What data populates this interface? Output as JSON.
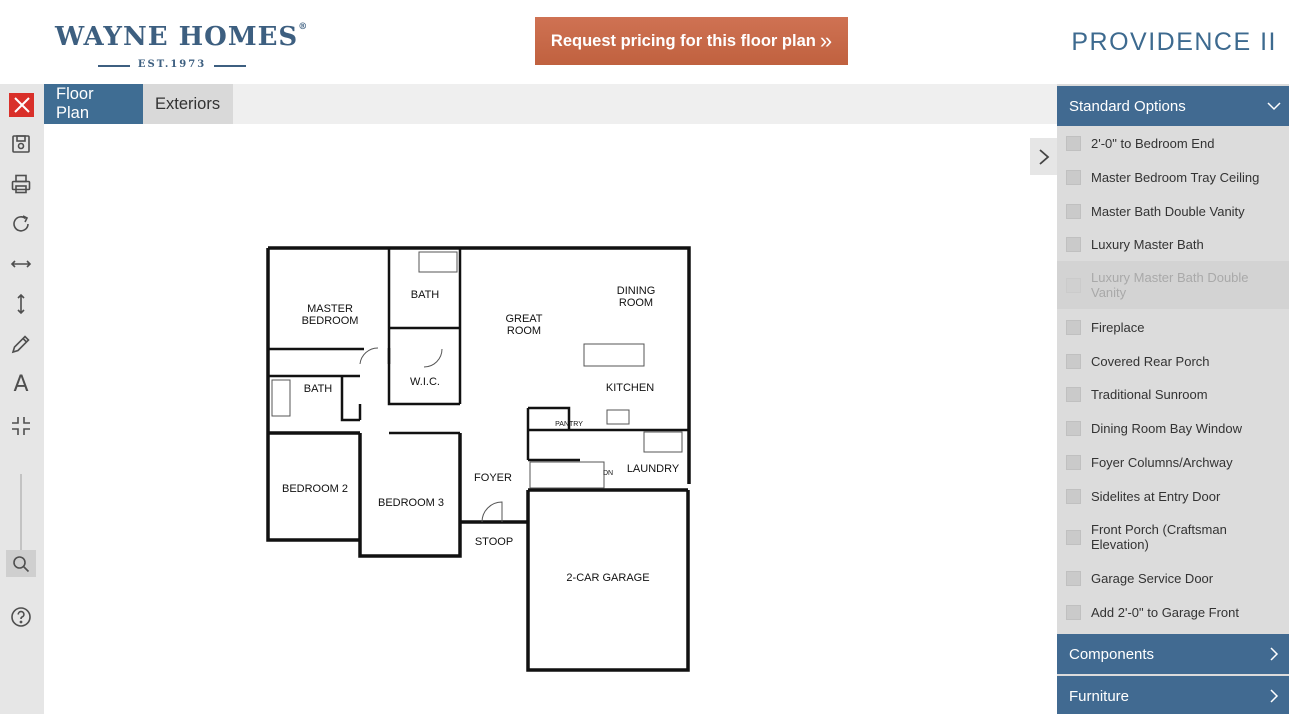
{
  "header": {
    "logo_main": "WAYNE HOMES",
    "logo_reg": "®",
    "logo_est": "EST.1973",
    "pricing_label": "Request pricing for this floor plan",
    "pricing_chevrons": "»",
    "plan_name": "PROVIDENCE II"
  },
  "tabs": [
    {
      "label": "Floor Plan"
    },
    {
      "label": "Exteriors"
    }
  ],
  "toolbar": {
    "text_tool": "A",
    "icons": [
      "close-icon",
      "save-icon",
      "print-icon",
      "redo-icon",
      "horizontal-measure-icon",
      "vertical-measure-icon",
      "pencil-icon",
      "text-icon",
      "collapse-icon",
      "search-icon",
      "help-icon"
    ]
  },
  "floorplan": {
    "rooms": {
      "master_bedroom_1": "MASTER",
      "master_bedroom_2": "BEDROOM",
      "bath_top": "BATH",
      "great_room_1": "GREAT",
      "great_room_2": "ROOM",
      "dining_1": "DINING",
      "dining_2": "ROOM",
      "wic": "W.I.C.",
      "bath_left": "BATH",
      "kitchen": "KITCHEN",
      "pantry": "PANTRY",
      "laundry": "LAUNDRY",
      "dn": "DN",
      "foyer": "FOYER",
      "bedroom2": "BEDROOM 2",
      "bedroom3": "BEDROOM 3",
      "stoop": "STOOP",
      "garage": "2-CAR GARAGE"
    }
  },
  "panel": {
    "standard_options": "Standard Options",
    "options": [
      {
        "label": "2'-0\" to Bedroom End",
        "disabled": false
      },
      {
        "label": "Master Bedroom Tray Ceiling",
        "disabled": false
      },
      {
        "label": "Master Bath Double Vanity",
        "disabled": false
      },
      {
        "label": "Luxury Master Bath",
        "disabled": false
      },
      {
        "label": "Luxury Master Bath Double Vanity",
        "disabled": true
      },
      {
        "label": "Fireplace",
        "disabled": false
      },
      {
        "label": "Covered Rear Porch",
        "disabled": false
      },
      {
        "label": "Traditional Sunroom",
        "disabled": false
      },
      {
        "label": "Dining Room Bay Window",
        "disabled": false
      },
      {
        "label": "Foyer Columns/Archway",
        "disabled": false
      },
      {
        "label": "Sidelites at Entry Door",
        "disabled": false
      },
      {
        "label": "Front Porch (Craftsman Elevation)",
        "disabled": false
      },
      {
        "label": "Garage Service Door",
        "disabled": false
      },
      {
        "label": "Add 2'-0\" to Garage Front",
        "disabled": false
      }
    ],
    "components": "Components",
    "furniture": "Furniture"
  },
  "colors": {
    "brand_blue": "#3f6d93",
    "pricing_orange": "#c8684a",
    "close_red": "#d9302a"
  }
}
